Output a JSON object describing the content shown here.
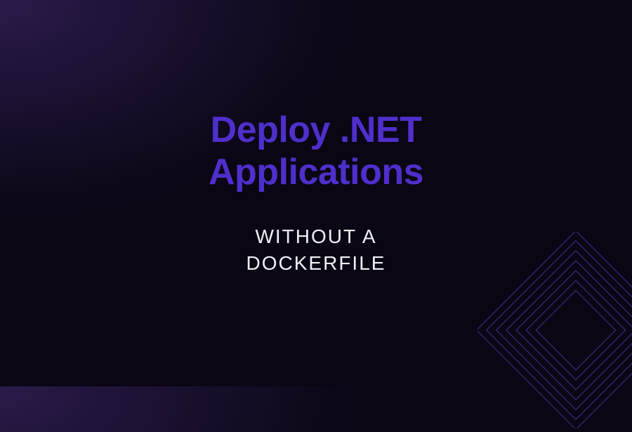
{
  "title_line1": "Deploy .NET",
  "title_line2": "Applications",
  "subtitle_line1": "WITHOUT A",
  "subtitle_line2": "DOCKERFILE",
  "colors": {
    "title": "#4f2fcc",
    "subtitle": "#f0f0f5",
    "background_dark": "#0a0614",
    "background_accent": "#2a1a4a",
    "decoration_stroke": "#4a2d8f"
  }
}
